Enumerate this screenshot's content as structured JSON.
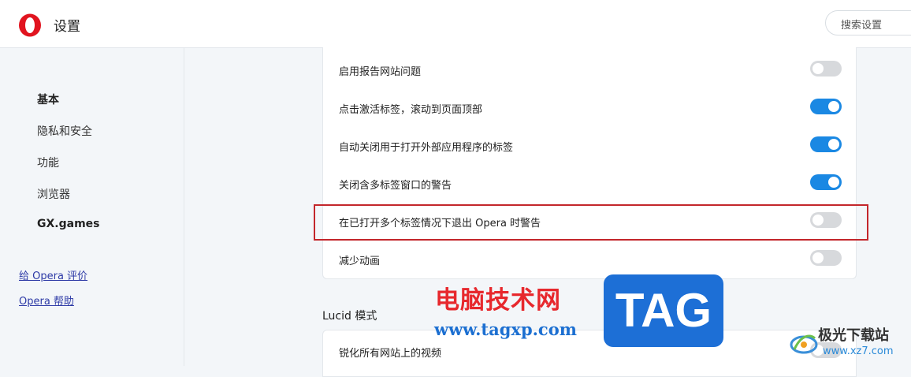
{
  "header": {
    "title": "设置",
    "search_placeholder": "搜索设置"
  },
  "sidebar": {
    "items": [
      {
        "label": "基本"
      },
      {
        "label": "隐私和安全"
      },
      {
        "label": "功能"
      },
      {
        "label": "浏览器"
      },
      {
        "label": "GX.games"
      }
    ],
    "links": [
      {
        "label": "给 Opera 评价"
      },
      {
        "label": "Opera 帮助"
      }
    ]
  },
  "settings": {
    "rows": [
      {
        "label": "启用报告网站问题",
        "on": false
      },
      {
        "label": "点击激活标签，滚动到页面顶部",
        "on": true
      },
      {
        "label": "自动关闭用于打开外部应用程序的标签",
        "on": true
      },
      {
        "label": "关闭含多标签窗口的警告",
        "on": true
      },
      {
        "label": "在已打开多个标签情况下退出 Opera 时警告",
        "on": false
      },
      {
        "label": "减少动画",
        "on": false
      }
    ]
  },
  "lucid": {
    "title": "Lucid 模式",
    "rows": [
      {
        "label": "锐化所有网站上的视频"
      }
    ]
  },
  "watermark": {
    "main": "电脑技术网",
    "url": "www.tagxp.com",
    "tag": "TAG",
    "site_name": "极光下载站",
    "site_url": "www.xz7.com"
  },
  "colors": {
    "accent": "#1a88e3",
    "highlight": "#c3262b",
    "opera_red": "#e1141f"
  }
}
